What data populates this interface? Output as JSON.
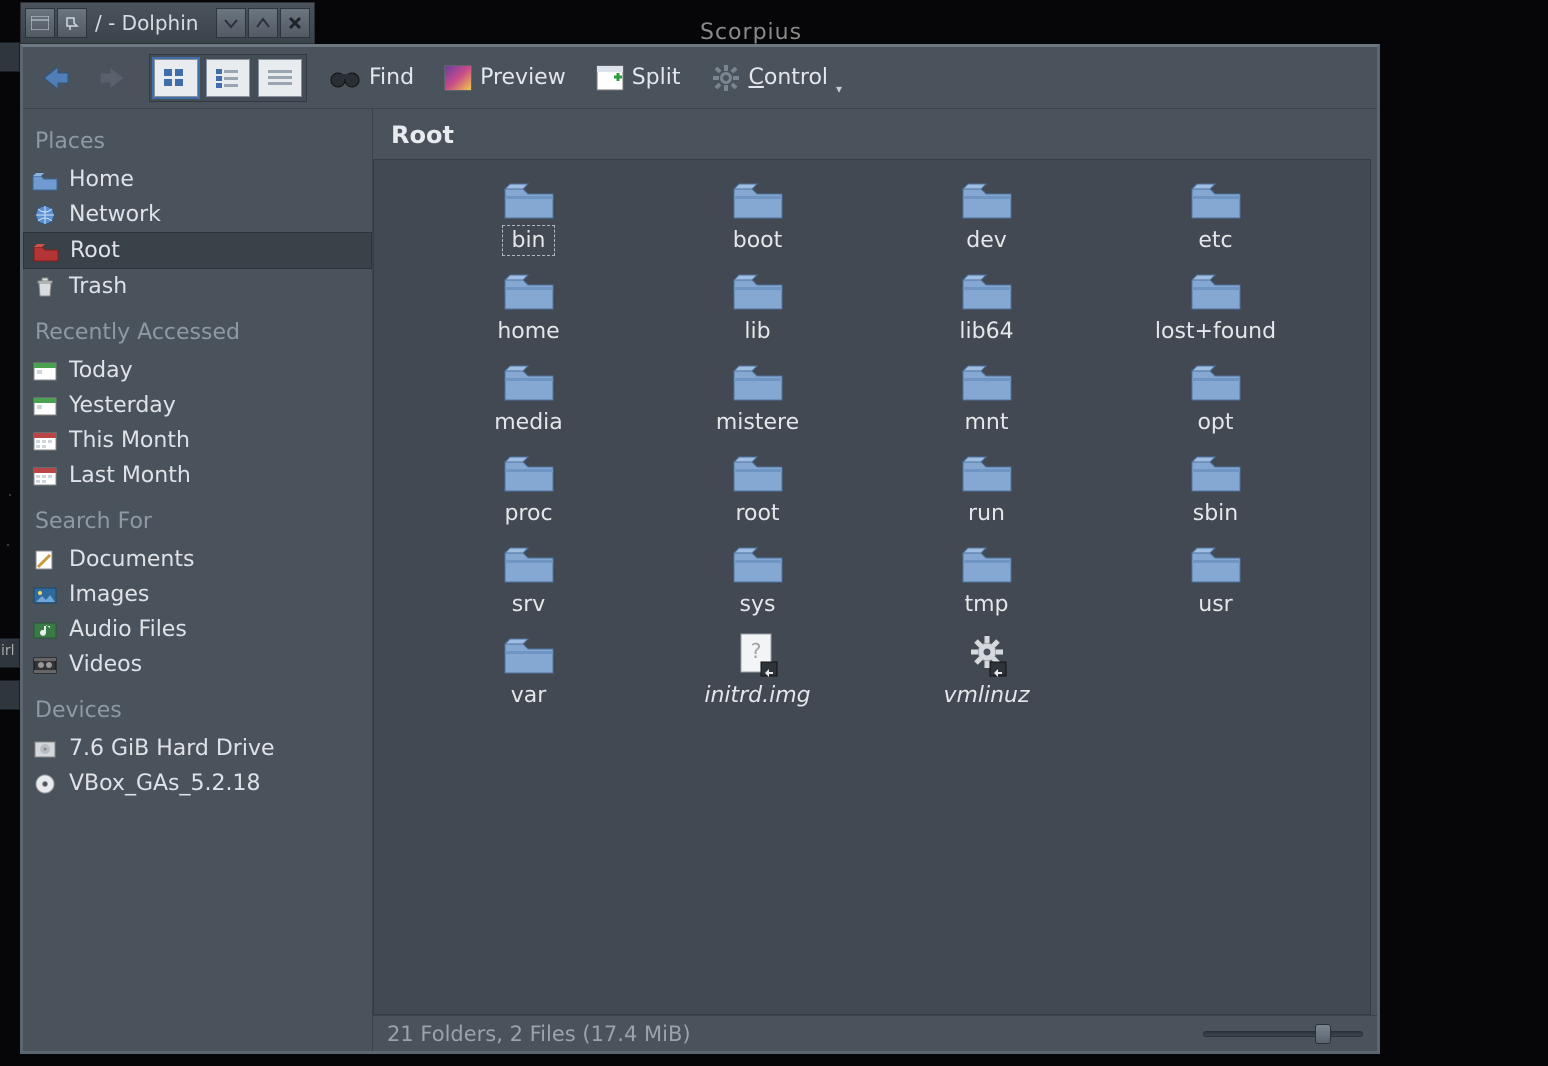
{
  "desktop": {
    "constellation_label": "Scorpius"
  },
  "titlebar": {
    "title": "/ - Dolphin"
  },
  "toolbar": {
    "find_label": "Find",
    "preview_label": "Preview",
    "split_label": "Split",
    "control_label": "Control"
  },
  "sidebar": {
    "sections": {
      "places": {
        "header": "Places",
        "items": [
          {
            "label": "Home",
            "icon": "home-folder-icon",
            "selected": false
          },
          {
            "label": "Network",
            "icon": "network-globe-icon",
            "selected": false
          },
          {
            "label": "Root",
            "icon": "root-folder-icon",
            "selected": true
          },
          {
            "label": "Trash",
            "icon": "trash-icon",
            "selected": false
          }
        ]
      },
      "recent": {
        "header": "Recently Accessed",
        "items": [
          {
            "label": "Today",
            "icon": "calendar-today-icon"
          },
          {
            "label": "Yesterday",
            "icon": "calendar-yesterday-icon"
          },
          {
            "label": "This Month",
            "icon": "calendar-month-icon"
          },
          {
            "label": "Last Month",
            "icon": "calendar-month-icon"
          }
        ]
      },
      "search": {
        "header": "Search For",
        "items": [
          {
            "label": "Documents",
            "icon": "documents-icon"
          },
          {
            "label": "Images",
            "icon": "images-icon"
          },
          {
            "label": "Audio Files",
            "icon": "audio-icon"
          },
          {
            "label": "Videos",
            "icon": "video-icon"
          }
        ]
      },
      "devices": {
        "header": "Devices",
        "items": [
          {
            "label": "7.6 GiB Hard Drive",
            "icon": "drive-icon"
          },
          {
            "label": "VBox_GAs_5.2.18",
            "icon": "optical-icon"
          }
        ]
      }
    }
  },
  "breadcrumb": {
    "location": "Root"
  },
  "items": [
    {
      "name": "bin",
      "type": "folder",
      "selected": true
    },
    {
      "name": "boot",
      "type": "folder"
    },
    {
      "name": "dev",
      "type": "folder"
    },
    {
      "name": "etc",
      "type": "folder"
    },
    {
      "name": "home",
      "type": "folder"
    },
    {
      "name": "lib",
      "type": "folder"
    },
    {
      "name": "lib64",
      "type": "folder"
    },
    {
      "name": "lost+found",
      "type": "folder"
    },
    {
      "name": "media",
      "type": "folder"
    },
    {
      "name": "mistere",
      "type": "folder"
    },
    {
      "name": "mnt",
      "type": "folder"
    },
    {
      "name": "opt",
      "type": "folder"
    },
    {
      "name": "proc",
      "type": "folder"
    },
    {
      "name": "root",
      "type": "folder"
    },
    {
      "name": "run",
      "type": "folder"
    },
    {
      "name": "sbin",
      "type": "folder"
    },
    {
      "name": "srv",
      "type": "folder"
    },
    {
      "name": "sys",
      "type": "folder"
    },
    {
      "name": "tmp",
      "type": "folder"
    },
    {
      "name": "usr",
      "type": "folder"
    },
    {
      "name": "var",
      "type": "folder"
    },
    {
      "name": "initrd.img",
      "type": "file-link"
    },
    {
      "name": "vmlinuz",
      "type": "exec-link"
    }
  ],
  "statusbar": {
    "text": "21 Folders, 2 Files (17.4 MiB)"
  }
}
